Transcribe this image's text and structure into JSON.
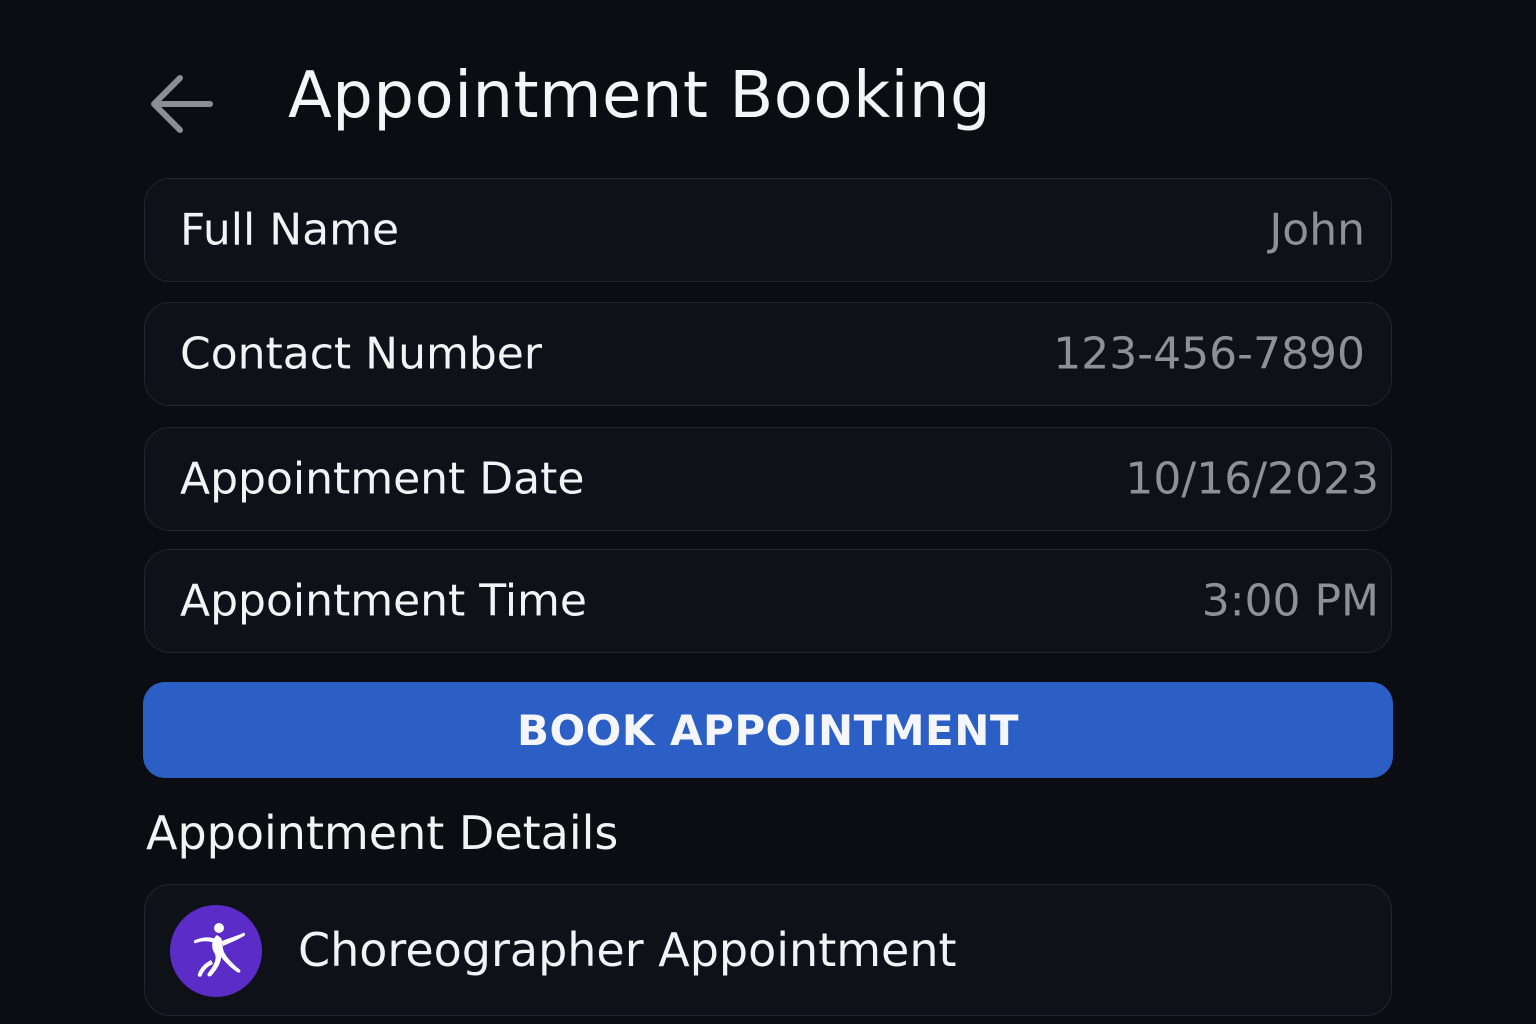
{
  "header": {
    "title": "Appointment Booking",
    "back_icon": "arrow-left-icon"
  },
  "form": {
    "fields": [
      {
        "label": "Full Name",
        "value": "John"
      },
      {
        "label": "Contact Number",
        "value": "123-456-7890"
      },
      {
        "label": "Appointment Date",
        "value": "10/16/2023"
      },
      {
        "label": "Appointment Time",
        "value": "3:00 PM"
      }
    ],
    "submit_label": "BOOK APPOINTMENT"
  },
  "details": {
    "section_title": "Appointment Details",
    "items": [
      {
        "label": "Choreographer Appointment",
        "icon": "dancer-icon"
      }
    ]
  },
  "colors": {
    "background": "#0b0d12",
    "accent": "#2c5fc6",
    "avatar": "#5b2cc7",
    "value_text": "#8c9097"
  }
}
